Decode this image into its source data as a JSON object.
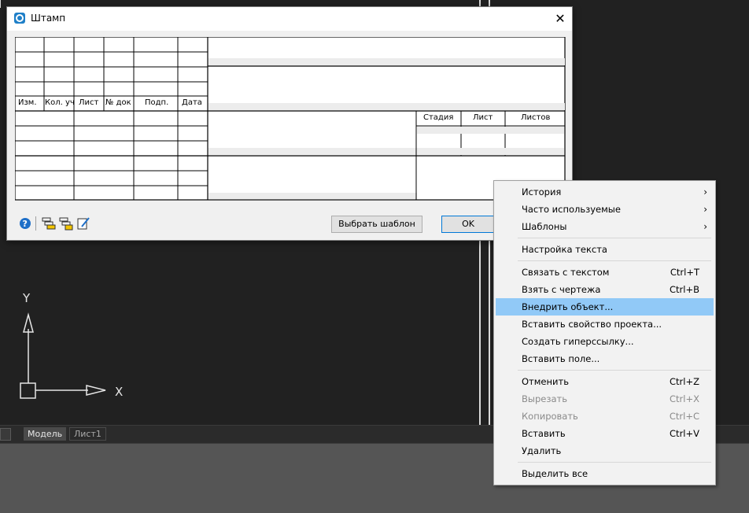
{
  "dialog": {
    "title": "Штамп",
    "close_icon": "close-icon",
    "stamp_headers": [
      "Изм.",
      "Кол. уч",
      "Лист",
      "№ док",
      "Подп.",
      "Дата"
    ],
    "stage_headers": [
      "Стадия",
      "Лист",
      "Листов"
    ],
    "select_template_label": "Выбрать шаблон",
    "ok_label": "OK",
    "toolbar_icons": [
      "help-icon",
      "stamp-insert-icon",
      "stamp-lock-icon",
      "stamp-edit-icon"
    ]
  },
  "tabs": {
    "model_label": "Модель",
    "sheet_label": "Лист1"
  },
  "axes": {
    "y_label": "Y",
    "x_label": "X"
  },
  "context_menu": {
    "items": [
      {
        "label": "История",
        "shortcut": "",
        "submenu": true,
        "disabled": false,
        "highlighted": false
      },
      {
        "label": "Часто используемые",
        "shortcut": "",
        "submenu": true,
        "disabled": false,
        "highlighted": false
      },
      {
        "label": "Шаблоны",
        "shortcut": "",
        "submenu": true,
        "disabled": false,
        "highlighted": false
      },
      {
        "label": "Настройка текста",
        "shortcut": "",
        "submenu": false,
        "disabled": false,
        "highlighted": false
      },
      {
        "label": "Связать с текстом",
        "shortcut": "Ctrl+T",
        "submenu": false,
        "disabled": false,
        "highlighted": false
      },
      {
        "label": "Взять с чертежа",
        "shortcut": "Ctrl+B",
        "submenu": false,
        "disabled": false,
        "highlighted": false
      },
      {
        "label": "Внедрить объект...",
        "shortcut": "",
        "submenu": false,
        "disabled": false,
        "highlighted": true
      },
      {
        "label": "Вставить свойство проекта...",
        "shortcut": "",
        "submenu": false,
        "disabled": false,
        "highlighted": false
      },
      {
        "label": "Создать гиперссылку...",
        "shortcut": "",
        "submenu": false,
        "disabled": false,
        "highlighted": false
      },
      {
        "label": "Вставить поле...",
        "shortcut": "",
        "submenu": false,
        "disabled": false,
        "highlighted": false
      },
      {
        "label": "Отменить",
        "shortcut": "Ctrl+Z",
        "submenu": false,
        "disabled": false,
        "highlighted": false
      },
      {
        "label": "Вырезать",
        "shortcut": "Ctrl+X",
        "submenu": false,
        "disabled": true,
        "highlighted": false
      },
      {
        "label": "Копировать",
        "shortcut": "Ctrl+C",
        "submenu": false,
        "disabled": true,
        "highlighted": false
      },
      {
        "label": "Вставить",
        "shortcut": "Ctrl+V",
        "submenu": false,
        "disabled": false,
        "highlighted": false
      },
      {
        "label": "Удалить",
        "shortcut": "",
        "submenu": false,
        "disabled": false,
        "highlighted": false
      },
      {
        "label": "Выделить все",
        "shortcut": "",
        "submenu": false,
        "disabled": false,
        "highlighted": false
      }
    ]
  },
  "colors": {
    "highlight": "#91c9f7",
    "cad_background": "#212121"
  }
}
